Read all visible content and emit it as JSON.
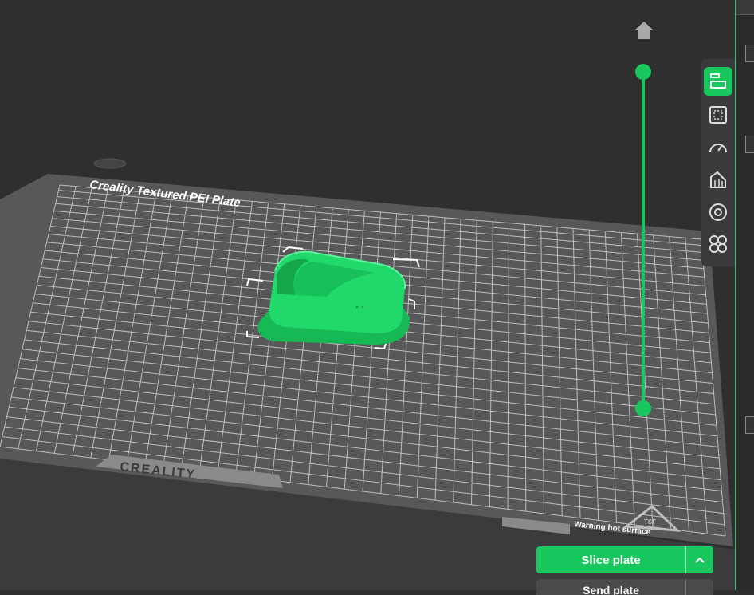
{
  "plate": {
    "title": "Creality Textured PEI Plate",
    "brand": "CREALITY",
    "warning": "Warning hot surface",
    "badge": "TSF"
  },
  "layer_slider": {
    "upper_value": 1.0,
    "lower_value": 0.0
  },
  "toolbar": {
    "items": [
      {
        "icon": "layers-icon",
        "active": true
      },
      {
        "icon": "bounding-box-icon",
        "active": false
      },
      {
        "icon": "speed-gauge-icon",
        "active": false
      },
      {
        "icon": "support-icon",
        "active": false
      },
      {
        "icon": "target-icon",
        "active": false
      },
      {
        "icon": "clover-icon",
        "active": false
      }
    ]
  },
  "actions": {
    "slice_label": "Slice plate",
    "second_label": "Send plate"
  },
  "colors": {
    "accent": "#18c75e",
    "background": "#2f2f30",
    "plate": "#565658",
    "grid": "#c9c9c9",
    "model": "#1ed767"
  }
}
